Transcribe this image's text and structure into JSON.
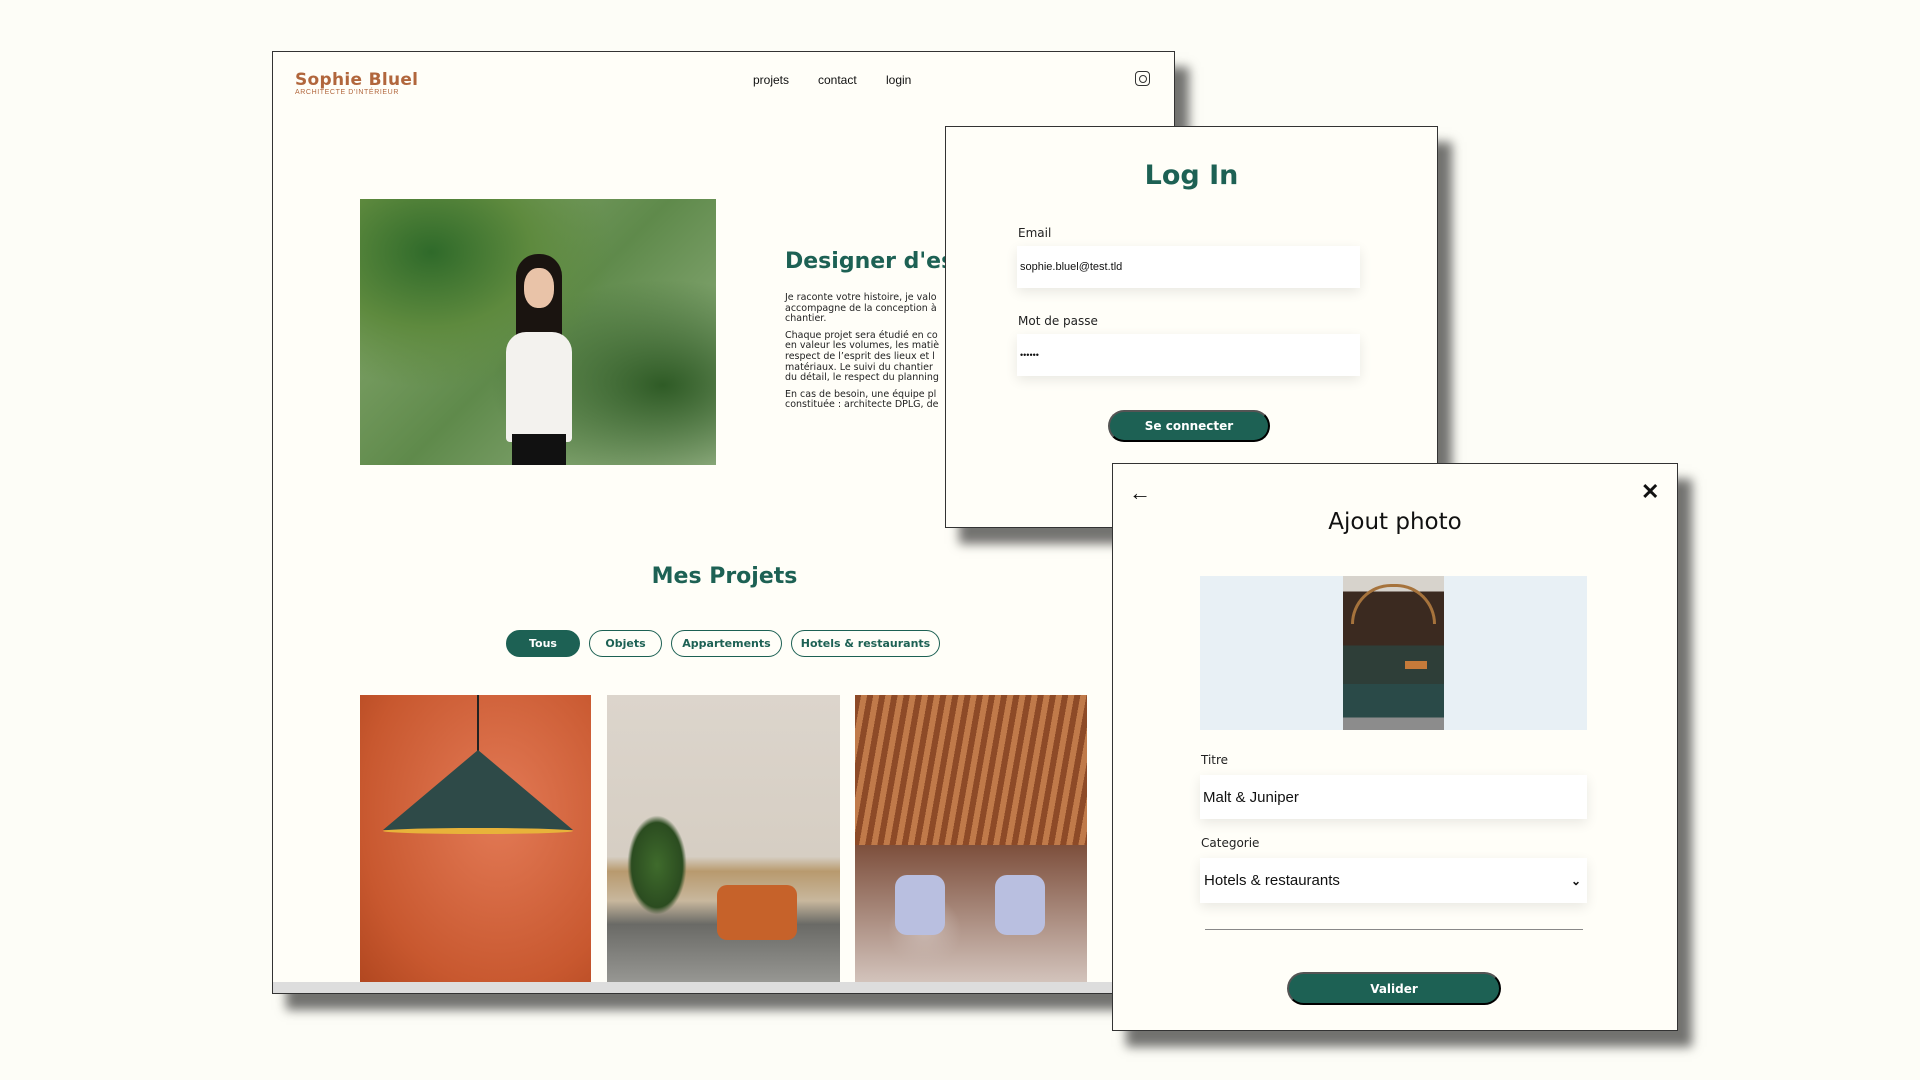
{
  "site": {
    "logo_name": "Sophie Bluel",
    "logo_subtitle": "ARCHITECTE D'INTÉRIEUR",
    "nav": [
      "projets",
      "contact",
      "login"
    ],
    "nav_icon": "instagram-icon",
    "intro_title": "Designer d'es",
    "intro_paragraphs": [
      [
        "Je raconte votre histoire, je valo",
        "accompagne de la conception à",
        "chantier."
      ],
      [
        "Chaque projet sera étudié en co",
        "en valeur les volumes, les matiè",
        "respect de l’esprit des lieux et l",
        "matériaux. Le suivi du chantier",
        "du détail, le respect du planning"
      ],
      [
        "En cas de besoin, une équipe pl",
        "constituée : architecte DPLG, de"
      ]
    ],
    "projects_title": "Mes Projets",
    "filters": [
      "Tous",
      "Objets",
      "Appartements",
      "Hotels & restaurants"
    ],
    "active_filter": "Tous"
  },
  "login": {
    "title": "Log In",
    "email_label": "Email",
    "email_value": "sophie.bluel@test.tld",
    "password_label": "Mot de passe",
    "password_value": "••••••",
    "submit": "Se connecter"
  },
  "modal": {
    "title": "Ajout photo",
    "back_icon": "arrow-left-icon",
    "close_icon": "close-icon",
    "title_label": "Titre",
    "title_value": "Malt & Juniper",
    "category_label": "Categorie",
    "category_value": "Hotels & restaurants",
    "submit": "Valider"
  },
  "colors": {
    "brand_green": "#1d6154",
    "brand_brown": "#b1663c",
    "background": "#fffef8"
  }
}
